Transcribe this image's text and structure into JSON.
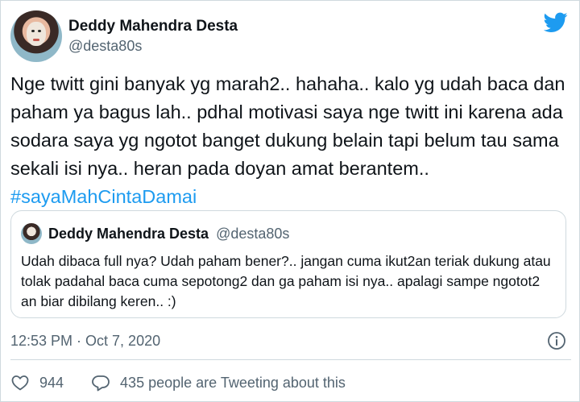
{
  "author": {
    "display_name": "Deddy Mahendra Desta",
    "handle": "@desta80s",
    "avatar_icon": "profile-photo"
  },
  "brand": {
    "icon": "twitter-bird-icon",
    "color": "#1d9bf0"
  },
  "tweet": {
    "text": "Nge twitt gini banyak yg marah2.. hahaha.. kalo yg udah baca dan paham ya bagus lah.. pdhal motivasi saya nge twitt ini karena ada sodara saya yg ngotot banget dukung belain tapi belum tau sama sekali isi nya.. heran pada doyan amat berantem..",
    "hashtag": "#sayaMahCintaDamai"
  },
  "quote": {
    "display_name": "Deddy Mahendra Desta",
    "handle": "@desta80s",
    "text": "Udah dibaca full nya? Udah paham bener?.. jangan cuma ikut2an teriak dukung atau tolak padahal baca cuma sepotong2 dan ga paham isi nya.. apalagi sampe ngotot2 an biar dibilang keren.. :)"
  },
  "meta": {
    "timestamp": "12:53 PM · Oct 7, 2020",
    "info_icon": "info-icon"
  },
  "actions": {
    "likes_count": "944",
    "like_icon": "heart-icon",
    "reply_icon": "speech-bubble-icon",
    "tweeting_label": "435 people are Tweeting about this"
  },
  "colors": {
    "text": "#0f1419",
    "secondary": "#536471",
    "link": "#1d9bf0",
    "border": "#cfd9de"
  }
}
